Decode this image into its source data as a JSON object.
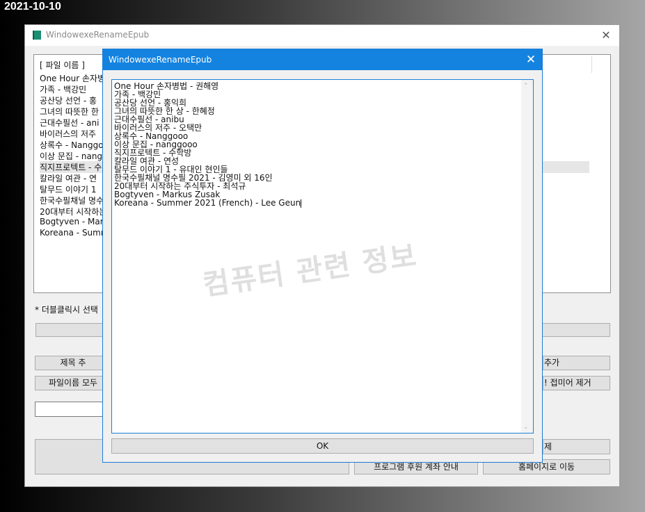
{
  "desktop": {
    "date": "2021-10-10"
  },
  "main_window": {
    "title": "WindowexeRenameEpub",
    "list_header": "[ 파일 이름 ]",
    "list_items": [
      "One Hour 손자병",
      "가족 - 백강민",
      "공산당 선언 - 홍",
      "그녀의 따뜻한 한",
      "근대수필선 - ani",
      "바이러스의 저주",
      "상록수 - Nanggo",
      "이상 문집 - nang",
      "직지프로텍트 - 수",
      "칼라일 여관 - 연",
      "탈무드 이야기 1",
      "한국수필채널 명수",
      "20대부터 시작하는",
      "Bogtyven - Mark",
      "Koreana - Summ"
    ],
    "note": "* 더블클릭시 선택",
    "buttons": {
      "title_extract": "제목 추",
      "filename_all": "파일이름 모두",
      "add": "추가",
      "remove_affix": "! 접미어 제거",
      "delete": "제",
      "donation": "프로그램 후원 계좌 안내",
      "homepage": "홈페이지로 이동"
    }
  },
  "dialog": {
    "title": "WindowexeRenameEpub",
    "lines": [
      "One Hour 손자병법 - 권해영",
      "가족 - 백강민",
      "공산당 선언 - 홍익희",
      "그녀의 따뜻한 한 상 - 한혜정",
      "근대수필선 - anibu",
      "바이러스의 저주 - 오택만",
      "상록수 - Nanggooo",
      "이상 문집 - nanggooo",
      "직지프로텍트 - 수학방",
      "칼라일 여관 - 연성",
      "탈무드 이야기 1 - 유대인 현인들",
      "한국수필채널 명수필 2021 - 김영미 외 16인",
      "20대부터 시작하는 주식투자  - 최석규",
      "Bogtyven - Markus Zusak",
      "Koreana - Summer 2021 (French) - Lee Geun"
    ],
    "ok_label": "OK"
  },
  "watermark": "컴퓨터 관련 정보",
  "icons": {
    "close": "✕",
    "scroll_up": "⌃",
    "scroll_down": "⌄"
  }
}
